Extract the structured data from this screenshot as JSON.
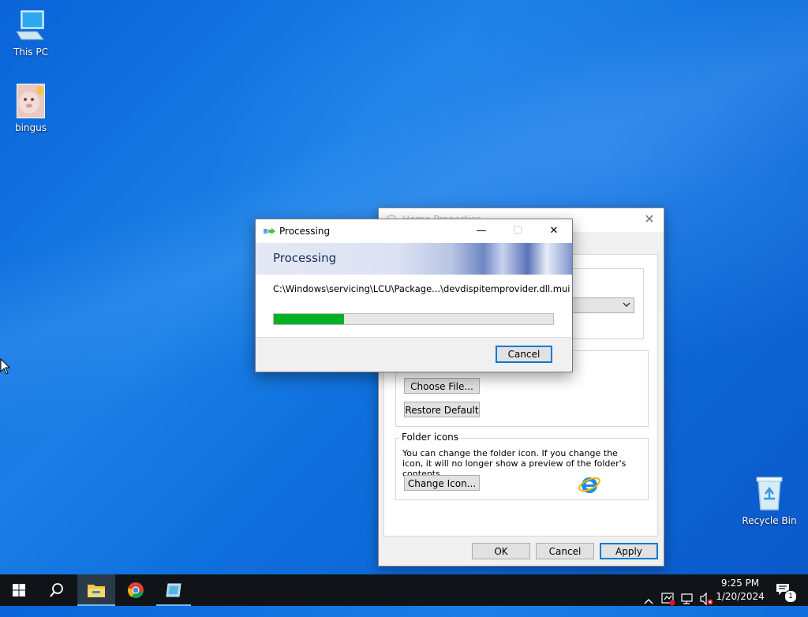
{
  "desktop": {
    "icons": [
      {
        "label": "This PC",
        "icon": "pc-icon"
      },
      {
        "label": "bingus",
        "icon": "image-thumbnail-icon"
      },
      {
        "label": "Recycle Bin",
        "icon": "recycle-bin-icon"
      }
    ]
  },
  "properties_dialog": {
    "title": "Home Properties",
    "close_glyph": "✕",
    "choose_file_label": "Choose File...",
    "restore_default_label": "Restore Default",
    "folder_icons_legend": "Folder icons",
    "folder_icons_desc": "You can change the folder icon. If you change the icon, it will no longer show a preview of the folder's contents.",
    "change_icon_label": "Change Icon...",
    "ok_label": "OK",
    "cancel_label": "Cancel",
    "apply_label": "Apply"
  },
  "processing_dialog": {
    "window_title": "Processing",
    "banner_title": "Processing",
    "current_file": "C:\\Windows\\servicing\\LCU\\Package...\\devdispitemprovider.dll.mui",
    "progress_percent": 25,
    "cancel_label": "Cancel",
    "minimize_glyph": "—",
    "maximize_glyph": "☐",
    "close_glyph": "✕"
  },
  "taskbar": {
    "clock_time": "9:25 PM",
    "clock_date": "1/20/2024",
    "notification_count": "1",
    "colors": {
      "background": "#101418",
      "active_item": "#2b3a48",
      "underline": "#76b9ed"
    }
  }
}
